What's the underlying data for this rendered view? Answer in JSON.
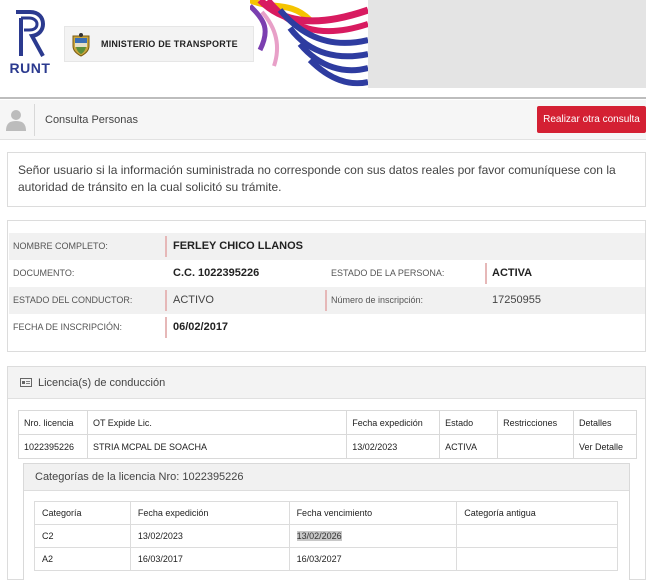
{
  "brand": {
    "logo_text": "RUNT",
    "ministerio": "MINISTERIO DE TRANSPORTE"
  },
  "header": {
    "title": "Consulta Personas",
    "new_query_label": "Realizar otra consulta"
  },
  "notice": {
    "text": "Señor usuario si la información suministrada no corresponde con sus datos reales por favor comuníquese con la autoridad de tránsito en la cual solicitó su trámite."
  },
  "person": {
    "nombre_label": "NOMBRE COMPLETO:",
    "nombre_value": "FERLEY CHICO LLANOS",
    "documento_label": "DOCUMENTO:",
    "documento_value": "C.C. 1022395226",
    "estado_persona_label": "ESTADO DE LA PERSONA:",
    "estado_persona_value": "ACTIVA",
    "estado_conductor_label": "ESTADO DEL CONDUCTOR:",
    "estado_conductor_value": "ACTIVO",
    "inscripcion_num_label": "Número de inscripción:",
    "inscripcion_num_value": "17250955",
    "fecha_inscripcion_label": "FECHA DE INSCRIPCIÓN:",
    "fecha_inscripcion_value": "06/02/2017"
  },
  "licencias": {
    "title": "Licencia(s) de conducción",
    "headers": [
      "Nro. licencia",
      "OT Expide Lic.",
      "Fecha expedición",
      "Estado",
      "Restricciones",
      "Detalles"
    ],
    "rows": [
      [
        "1022395226",
        "STRIA MCPAL DE SOACHA",
        "13/02/2023",
        "ACTIVA",
        "",
        "Ver Detalle"
      ]
    ]
  },
  "categorias": {
    "title": "Categorías de la licencia Nro: 1022395226",
    "headers": [
      "Categoría",
      "Fecha expedición",
      "Fecha vencimiento",
      "Categoría antigua"
    ],
    "rows": [
      [
        "C2",
        "13/02/2023",
        "13/02/2026",
        ""
      ],
      [
        "A2",
        "16/03/2017",
        "16/03/2027",
        ""
      ]
    ]
  },
  "colors": {
    "accent_red": "#d42033",
    "brand_blue": "#2b3a8f"
  }
}
